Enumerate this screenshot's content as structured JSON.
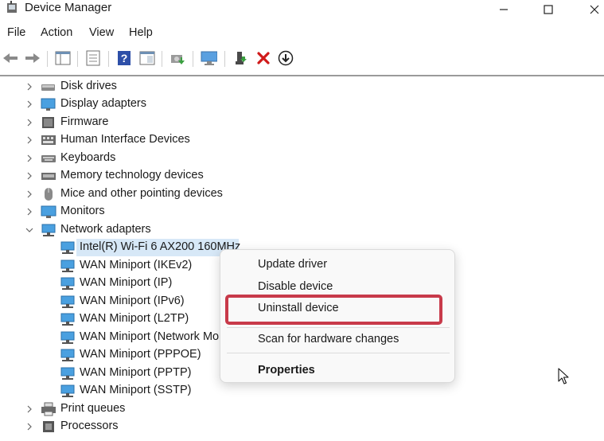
{
  "window": {
    "title": "Device Manager"
  },
  "menu": [
    "File",
    "Action",
    "View",
    "Help"
  ],
  "tree": {
    "categories_top": [
      {
        "label": "Disk drives",
        "icon": "disk-drive-icon"
      },
      {
        "label": "Display adapters",
        "icon": "display-adapter-icon"
      },
      {
        "label": "Firmware",
        "icon": "firmware-icon"
      },
      {
        "label": "Human Interface Devices",
        "icon": "hid-icon"
      },
      {
        "label": "Keyboards",
        "icon": "keyboard-icon"
      },
      {
        "label": "Memory technology devices",
        "icon": "memory-icon"
      },
      {
        "label": "Mice and other pointing devices",
        "icon": "mouse-icon"
      },
      {
        "label": "Monitors",
        "icon": "monitor-icon"
      }
    ],
    "expanded_category": {
      "label": "Network adapters",
      "icon": "network-adapter-icon"
    },
    "network_adapters": [
      "Intel(R) Wi-Fi 6 AX200 160MHz",
      "WAN Miniport (IKEv2)",
      "WAN Miniport (IP)",
      "WAN Miniport (IPv6)",
      "WAN Miniport (L2TP)",
      "WAN Miniport (Network Monitor)",
      "WAN Miniport (PPPOE)",
      "WAN Miniport (PPTP)",
      "WAN Miniport (SSTP)"
    ],
    "categories_bottom": [
      {
        "label": "Print queues",
        "icon": "printer-icon"
      },
      {
        "label": "Processors",
        "icon": "processor-icon"
      }
    ]
  },
  "context_menu": {
    "items": [
      "Update driver",
      "Disable device",
      "Uninstall device",
      "Scan for hardware changes",
      "Properties"
    ],
    "highlighted": "Uninstall device"
  },
  "colors": {
    "selection": "#d7e8f7",
    "highlight_border": "#c83a4a",
    "accent": "#1a6fd0"
  }
}
